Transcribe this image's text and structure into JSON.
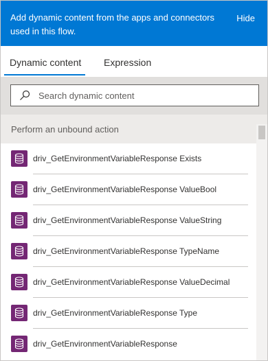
{
  "header": {
    "message": "Add dynamic content from the apps and connectors used in this flow.",
    "hide_label": "Hide",
    "background": "#0078d4"
  },
  "tabs": [
    {
      "label": "Dynamic content",
      "active": true
    },
    {
      "label": "Expression",
      "active": false
    }
  ],
  "search": {
    "placeholder": "Search dynamic content",
    "value": ""
  },
  "section": {
    "title": "Perform an unbound action"
  },
  "items": [
    {
      "label": "driv_GetEnvironmentVariableResponse Exists",
      "icon": "database-icon"
    },
    {
      "label": "driv_GetEnvironmentVariableResponse ValueBool",
      "icon": "database-icon"
    },
    {
      "label": "driv_GetEnvironmentVariableResponse ValueString",
      "icon": "database-icon"
    },
    {
      "label": "driv_GetEnvironmentVariableResponse TypeName",
      "icon": "database-icon"
    },
    {
      "label": "driv_GetEnvironmentVariableResponse ValueDecimal",
      "icon": "database-icon"
    },
    {
      "label": "driv_GetEnvironmentVariableResponse Type",
      "icon": "database-icon"
    },
    {
      "label": "driv_GetEnvironmentVariableResponse",
      "icon": "database-icon"
    }
  ],
  "colors": {
    "accent": "#0078d4",
    "icon_tile": "#742774",
    "section_bg": "#edebe9",
    "search_area_bg": "#e1dfdd"
  }
}
